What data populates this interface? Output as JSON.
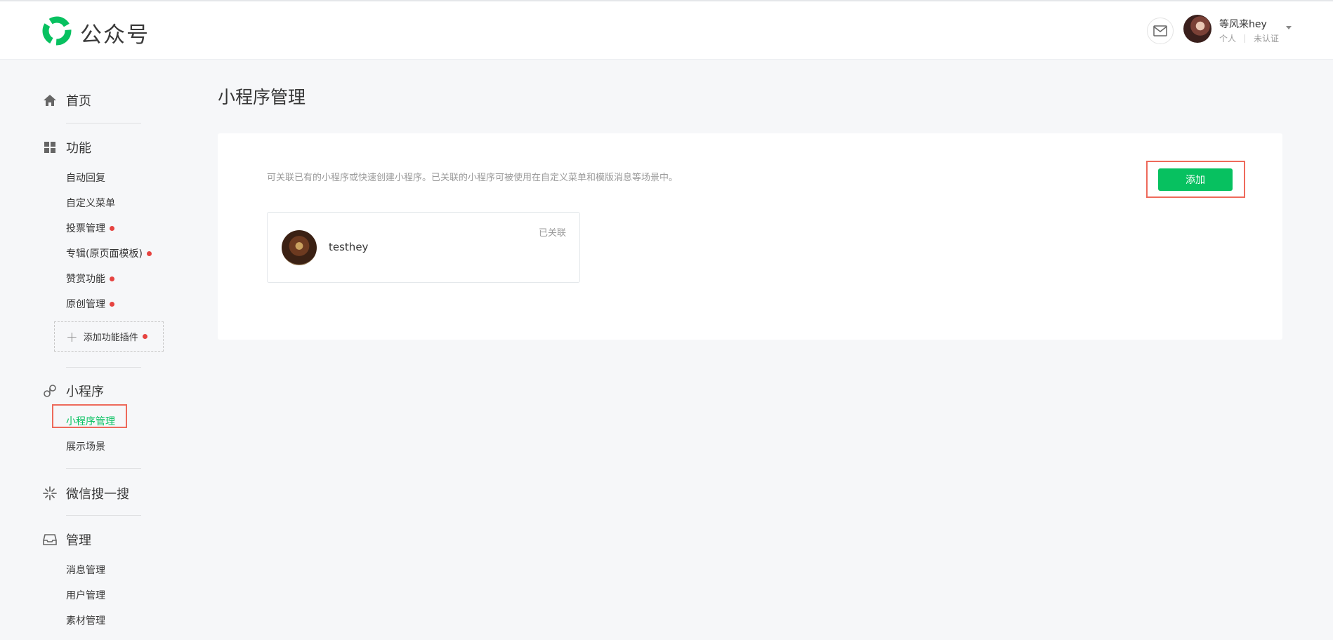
{
  "header": {
    "brand": "公众号",
    "user": {
      "name": "等风来hey",
      "type": "个人",
      "verify": "未认证"
    }
  },
  "sidebar": {
    "home": "首页",
    "features": {
      "title": "功能",
      "items": [
        "自动回复",
        "自定义菜单",
        "投票管理",
        "专辑(原页面模板)",
        "赞赏功能",
        "原创管理"
      ],
      "add_plugin": "添加功能插件"
    },
    "miniprogram": {
      "title": "小程序",
      "items": [
        "小程序管理",
        "展示场景"
      ]
    },
    "search": "微信搜一搜",
    "manage": {
      "title": "管理",
      "items": [
        "消息管理",
        "用户管理",
        "素材管理"
      ]
    }
  },
  "main": {
    "title": "小程序管理",
    "description": "可关联已有的小程序或快速创建小程序。已关联的小程序可被使用在自定义菜单和模版消息等场景中。",
    "add_button": "添加",
    "apps": [
      {
        "name": "testhey",
        "status": "已关联"
      }
    ]
  },
  "colors": {
    "accent": "#07c160",
    "badge": "#e64340",
    "highlight": "#ee6a5b"
  }
}
